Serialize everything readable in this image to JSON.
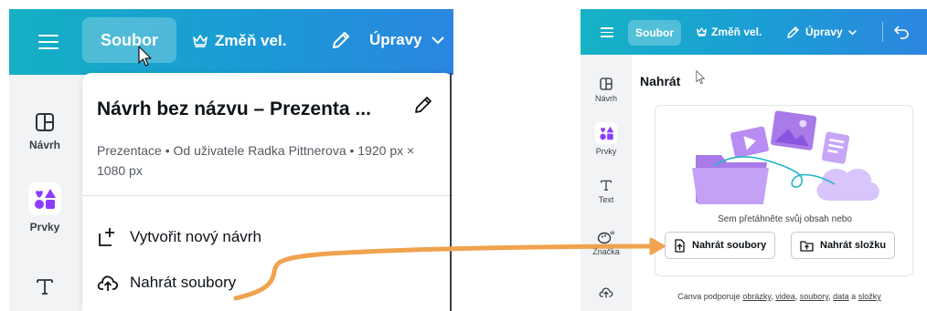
{
  "left": {
    "topbar": {
      "file_label": "Soubor",
      "resize_label": "Změň vel.",
      "edit_label": "Úpravy"
    },
    "rail": {
      "design_label": "Návrh",
      "elements_label": "Prvky"
    },
    "menu": {
      "title": "Návrh bez názvu – Prezenta ...",
      "meta": "Prezentace • Od uživatele Radka Pittnerova • 1920 px × 1080 px",
      "new_design_label": "Vytvořit nový návrh",
      "upload_files_label": "Nahrát soubory"
    }
  },
  "right": {
    "topbar": {
      "file_label": "Soubor",
      "resize_label": "Změň vel.",
      "edit_label": "Úpravy"
    },
    "rail": {
      "design_label": "Návrh",
      "elements_label": "Prvky",
      "text_label": "Text",
      "brand_label": "Značka"
    },
    "upload": {
      "title": "Nahrát",
      "drop_hint": "Sem přetáhněte svůj obsah nebo",
      "upload_files_button": "Nahrát soubory",
      "upload_folder_button": "Nahrát složku",
      "support_prefix": "Canva podporuje",
      "support_images": "obrázky",
      "support_videos": "videa",
      "support_files": "soubory",
      "support_data": "data",
      "support_and": "a",
      "support_folders": "složky"
    }
  },
  "colors": {
    "topbar_start": "#14b0c4",
    "topbar_end": "#2a86e0",
    "arrow": "#f0a24e",
    "elements_icon": "#8b3dff",
    "illustration_purple": "#b98cf5",
    "illustration_teal": "#1fb6c9"
  },
  "icons": {
    "menu": "hamburger-icon",
    "crown": "crown-icon",
    "edit": "pencil-icon",
    "chevron": "chevron-down-icon",
    "undo": "undo-icon",
    "new": "new-design-icon",
    "upload": "cloud-upload-icon",
    "folder": "folder-upload-icon"
  }
}
